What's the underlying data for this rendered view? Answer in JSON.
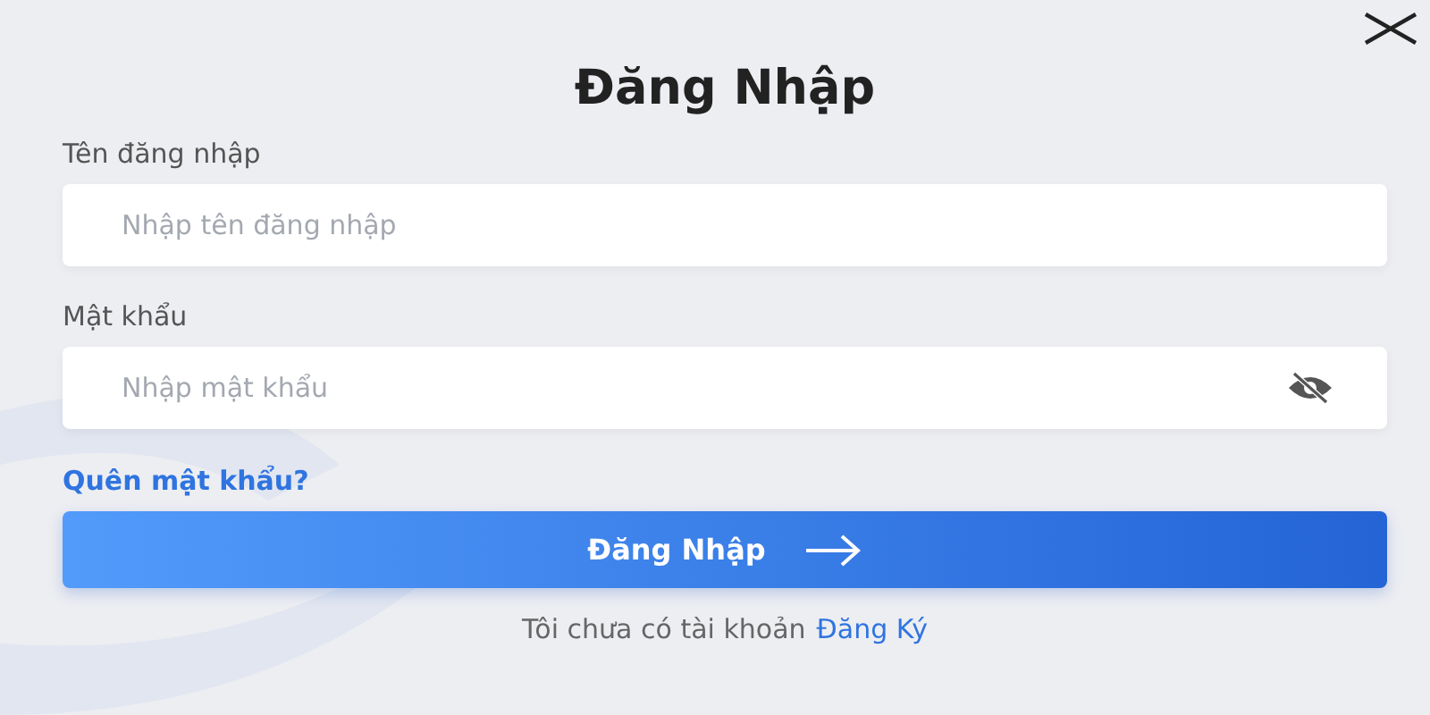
{
  "dialog": {
    "title": "Đăng Nhập"
  },
  "fields": [
    {
      "label": "Tên đăng nhập",
      "placeholder": "Nhập tên đăng nhập",
      "kind": "text"
    },
    {
      "label": "Mật khẩu",
      "placeholder": "Nhập mật khẩu",
      "kind": "password"
    }
  ],
  "forgot_link": "Quên mật khẩu?",
  "submit_button": "Đăng Nhập",
  "signup": {
    "text": "Tôi chưa có tài khoản",
    "link": "Đăng Ký"
  }
}
